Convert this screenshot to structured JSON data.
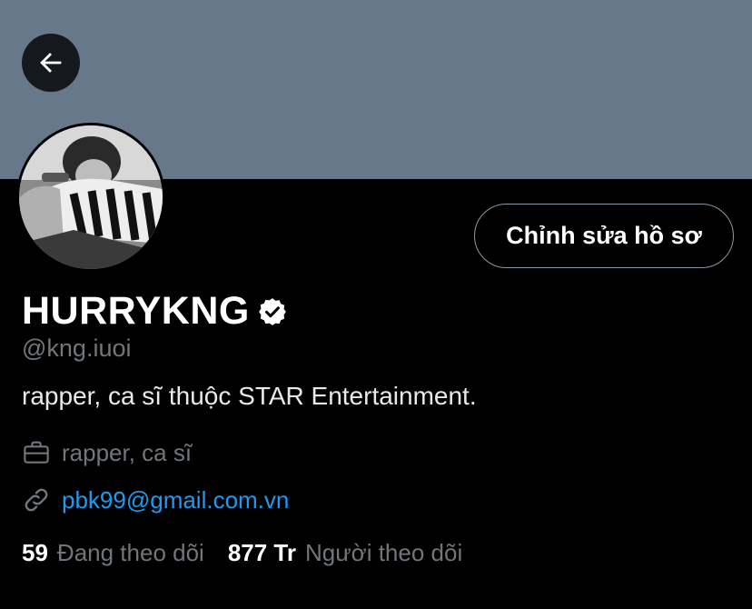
{
  "header": {
    "back_icon": "arrow-left-icon",
    "banner_color": "#66788a"
  },
  "profile": {
    "edit_button_label": "Chỉnh sửa hồ sơ",
    "display_name": "HURRYKNG",
    "verified_icon": "verified-badge-icon",
    "handle": "@kng.iuoi",
    "bio": "rapper, ca sĩ thuộc STAR Entertainment.",
    "profession": {
      "icon": "briefcase-icon",
      "text": "rapper, ca sĩ"
    },
    "link": {
      "icon": "link-icon",
      "text": "pbk99@gmail.com.vn"
    },
    "following": {
      "count": "59",
      "label": "Đang theo dõi"
    },
    "followers": {
      "count": "877 Tr",
      "label": "Người theo dõi"
    }
  },
  "colors": {
    "accent_link": "#1d9bf0",
    "muted_text": "#71767b",
    "background": "#000000"
  }
}
